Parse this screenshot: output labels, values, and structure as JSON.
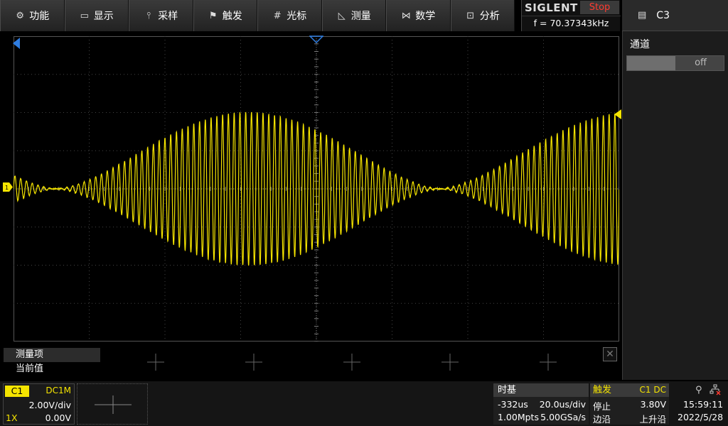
{
  "menu": [
    {
      "icon": "gear-icon",
      "glyph": "⚙",
      "label": "功能"
    },
    {
      "icon": "monitor-icon",
      "glyph": "🖵",
      "label": "显示"
    },
    {
      "icon": "acquire-icon",
      "glyph": "⫯",
      "label": "采样"
    },
    {
      "icon": "flag-icon",
      "glyph": "⚑",
      "label": "触发"
    },
    {
      "icon": "cursor-icon",
      "glyph": "⌗",
      "label": "光标"
    },
    {
      "icon": "measure-icon",
      "glyph": "◺",
      "label": "测量"
    },
    {
      "icon": "math-icon",
      "glyph": "⋈",
      "label": "数学"
    },
    {
      "icon": "analysis-icon",
      "glyph": "⊡",
      "label": "分析"
    }
  ],
  "brand": {
    "name": "SIGLENT",
    "status": "Stop",
    "frequency": "f = 70.37343kHz"
  },
  "right_panel": {
    "title": "C3",
    "label": "通道",
    "toggle_value": "off"
  },
  "measure": {
    "row1": "测量项",
    "row2": "当前值"
  },
  "channel1": {
    "tag": "C1",
    "coupling": "DC1M",
    "scale": "2.00V/div",
    "probe": "1X",
    "offset": "0.00V"
  },
  "timebase": {
    "title": "时基",
    "delay": "-332us",
    "scale": "20.0us/div",
    "points": "1.00Mpts",
    "sample_rate": "5.00GSa/s"
  },
  "trigger": {
    "title": "触发",
    "source": "C1 DC",
    "mode": "停止",
    "level": "3.80V",
    "type": "边沿",
    "slope": "上升沿"
  },
  "status": {
    "time": "15:59:11",
    "date": "2022/5/28"
  },
  "colors": {
    "channel1": "#f5e400",
    "stop": "#ff3b30",
    "marker_blue": "#2f7de1"
  },
  "waveform": {
    "carrier_frequency_khz": 70.37343,
    "timebase_us_per_div": 20.0,
    "volts_per_div": 2.0
  }
}
